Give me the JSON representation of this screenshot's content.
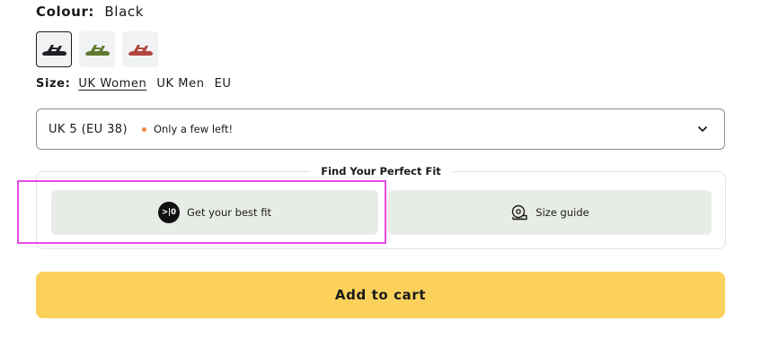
{
  "colour": {
    "label": "Colour:",
    "value": "Black"
  },
  "swatches": [
    {
      "name": "black-sandal",
      "color": "#1f1f24",
      "selected": true
    },
    {
      "name": "olive-sandal",
      "color": "#5f7a32",
      "selected": false
    },
    {
      "name": "red-sandal",
      "color": "#b0463f",
      "selected": false
    }
  ],
  "size": {
    "label": "Size:",
    "options": [
      "UK Women",
      "UK Men",
      "EU"
    ],
    "active": "UK Women"
  },
  "size_select": {
    "value": "UK 5 (EU 38)",
    "stock_note": "Only a few left!",
    "stock_color": "#f0883e",
    "chevron_icon": "chevron-down-icon"
  },
  "fit": {
    "title": "Find Your Perfect Fit",
    "best_fit": {
      "logo_text": ">|0",
      "label": "Get your best fit",
      "icon": "best-fit-logo-icon"
    },
    "size_guide": {
      "label": "Size guide",
      "icon": "measuring-tape-icon"
    }
  },
  "cart": {
    "label": "Add to cart",
    "color": "#fbd15b"
  },
  "highlight_color": "#e84be8"
}
